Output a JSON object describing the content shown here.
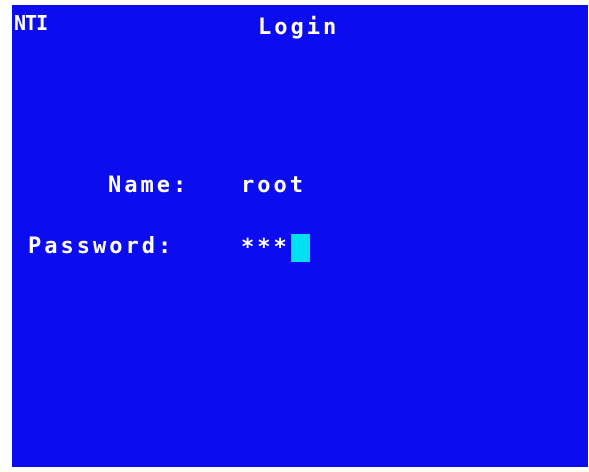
{
  "header": {
    "logo": "NTI",
    "title": "Login"
  },
  "form": {
    "name_label": "Name:",
    "name_value": "root",
    "password_label": "Password:",
    "password_value": "***"
  },
  "colors": {
    "background": "#0c0cf0",
    "text": "#ffffff",
    "cursor": "#00e0f0"
  }
}
